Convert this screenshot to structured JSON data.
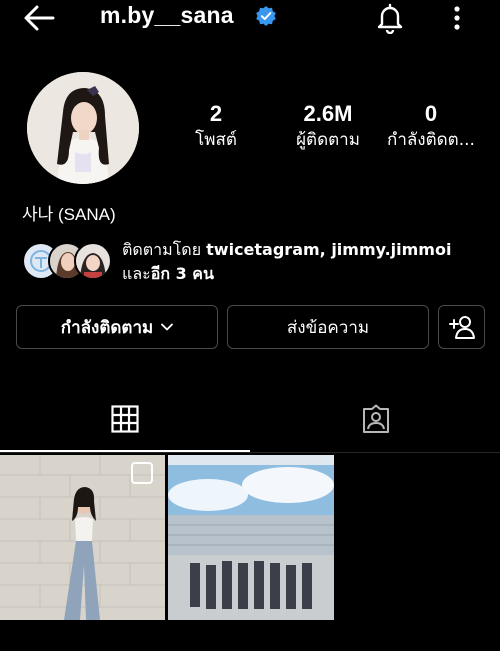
{
  "header": {
    "username": "m.by__sana",
    "verified": true,
    "icons": [
      "back-arrow-icon",
      "verified-badge-icon",
      "bell-icon",
      "more-vertical-icon"
    ]
  },
  "profile": {
    "display_name": "사나 (SANA)",
    "stats": {
      "posts": {
        "value": "2",
        "label": "โพสต์"
      },
      "followers": {
        "value": "2.6M",
        "label": "ผู้ติดตาม"
      },
      "following": {
        "value": "0",
        "label": "กำลังติดต..."
      }
    }
  },
  "mutual": {
    "prefix": "ติดตามโดย ",
    "names": "twicetagram, jimmy.jimmoi",
    "line2_prefix": "และ",
    "others": "อีก 3 คน"
  },
  "actions": {
    "following_label": "กำลังติดตาม",
    "message_label": "ส่งข้อความ"
  },
  "tabs": [
    "grid-icon",
    "tagged-user-icon"
  ],
  "colors": {
    "background": "#000000",
    "verified_blue": "#3897f0",
    "button_border": "#4a4a4a"
  }
}
